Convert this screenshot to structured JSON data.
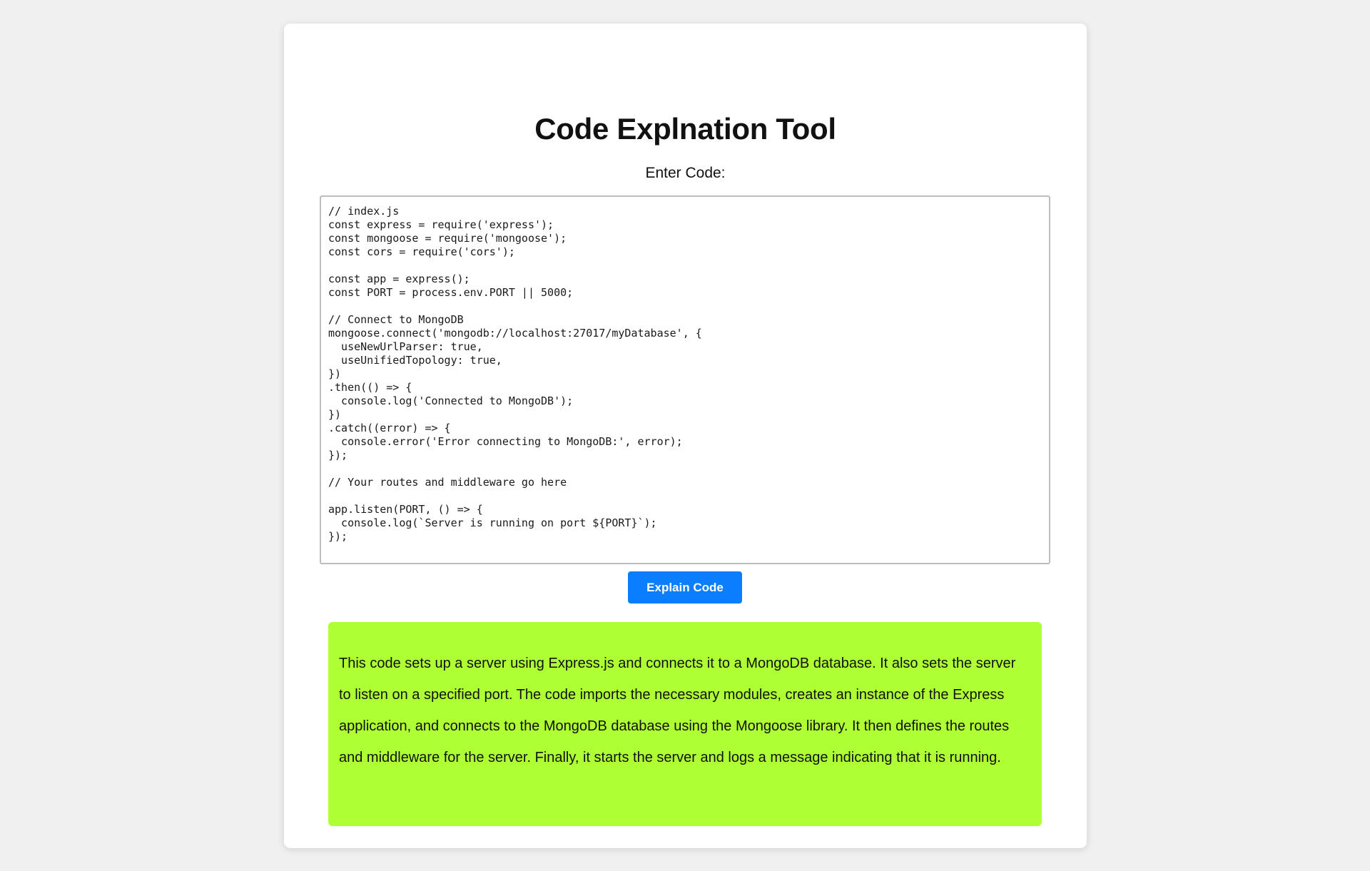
{
  "page": {
    "title": "Code Explnation Tool",
    "code_label": "Enter Code:",
    "code_value": "// index.js\nconst express = require('express');\nconst mongoose = require('mongoose');\nconst cors = require('cors');\n\nconst app = express();\nconst PORT = process.env.PORT || 5000;\n\n// Connect to MongoDB\nmongoose.connect('mongodb://localhost:27017/myDatabase', {\n  useNewUrlParser: true,\n  useUnifiedTopology: true,\n})\n.then(() => {\n  console.log('Connected to MongoDB');\n})\n.catch((error) => {\n  console.error('Error connecting to MongoDB:', error);\n});\n\n// Your routes and middleware go here\n\napp.listen(PORT, () => {\n  console.log(`Server is running on port ${PORT}`);\n});",
    "button_label": "Explain Code",
    "explanation": "This code sets up a server using Express.js and connects it to a MongoDB database. It also sets the server to listen on a specified port. The code imports the necessary modules, creates an instance of the Express application, and connects to the MongoDB database using the Mongoose library. It then defines the routes and middleware for the server. Finally, it starts the server and logs a message indicating that it is running."
  },
  "colors": {
    "background": "#f0f0f0",
    "card": "#ffffff",
    "button": "#0b7dff",
    "result_background": "#aeff33"
  }
}
